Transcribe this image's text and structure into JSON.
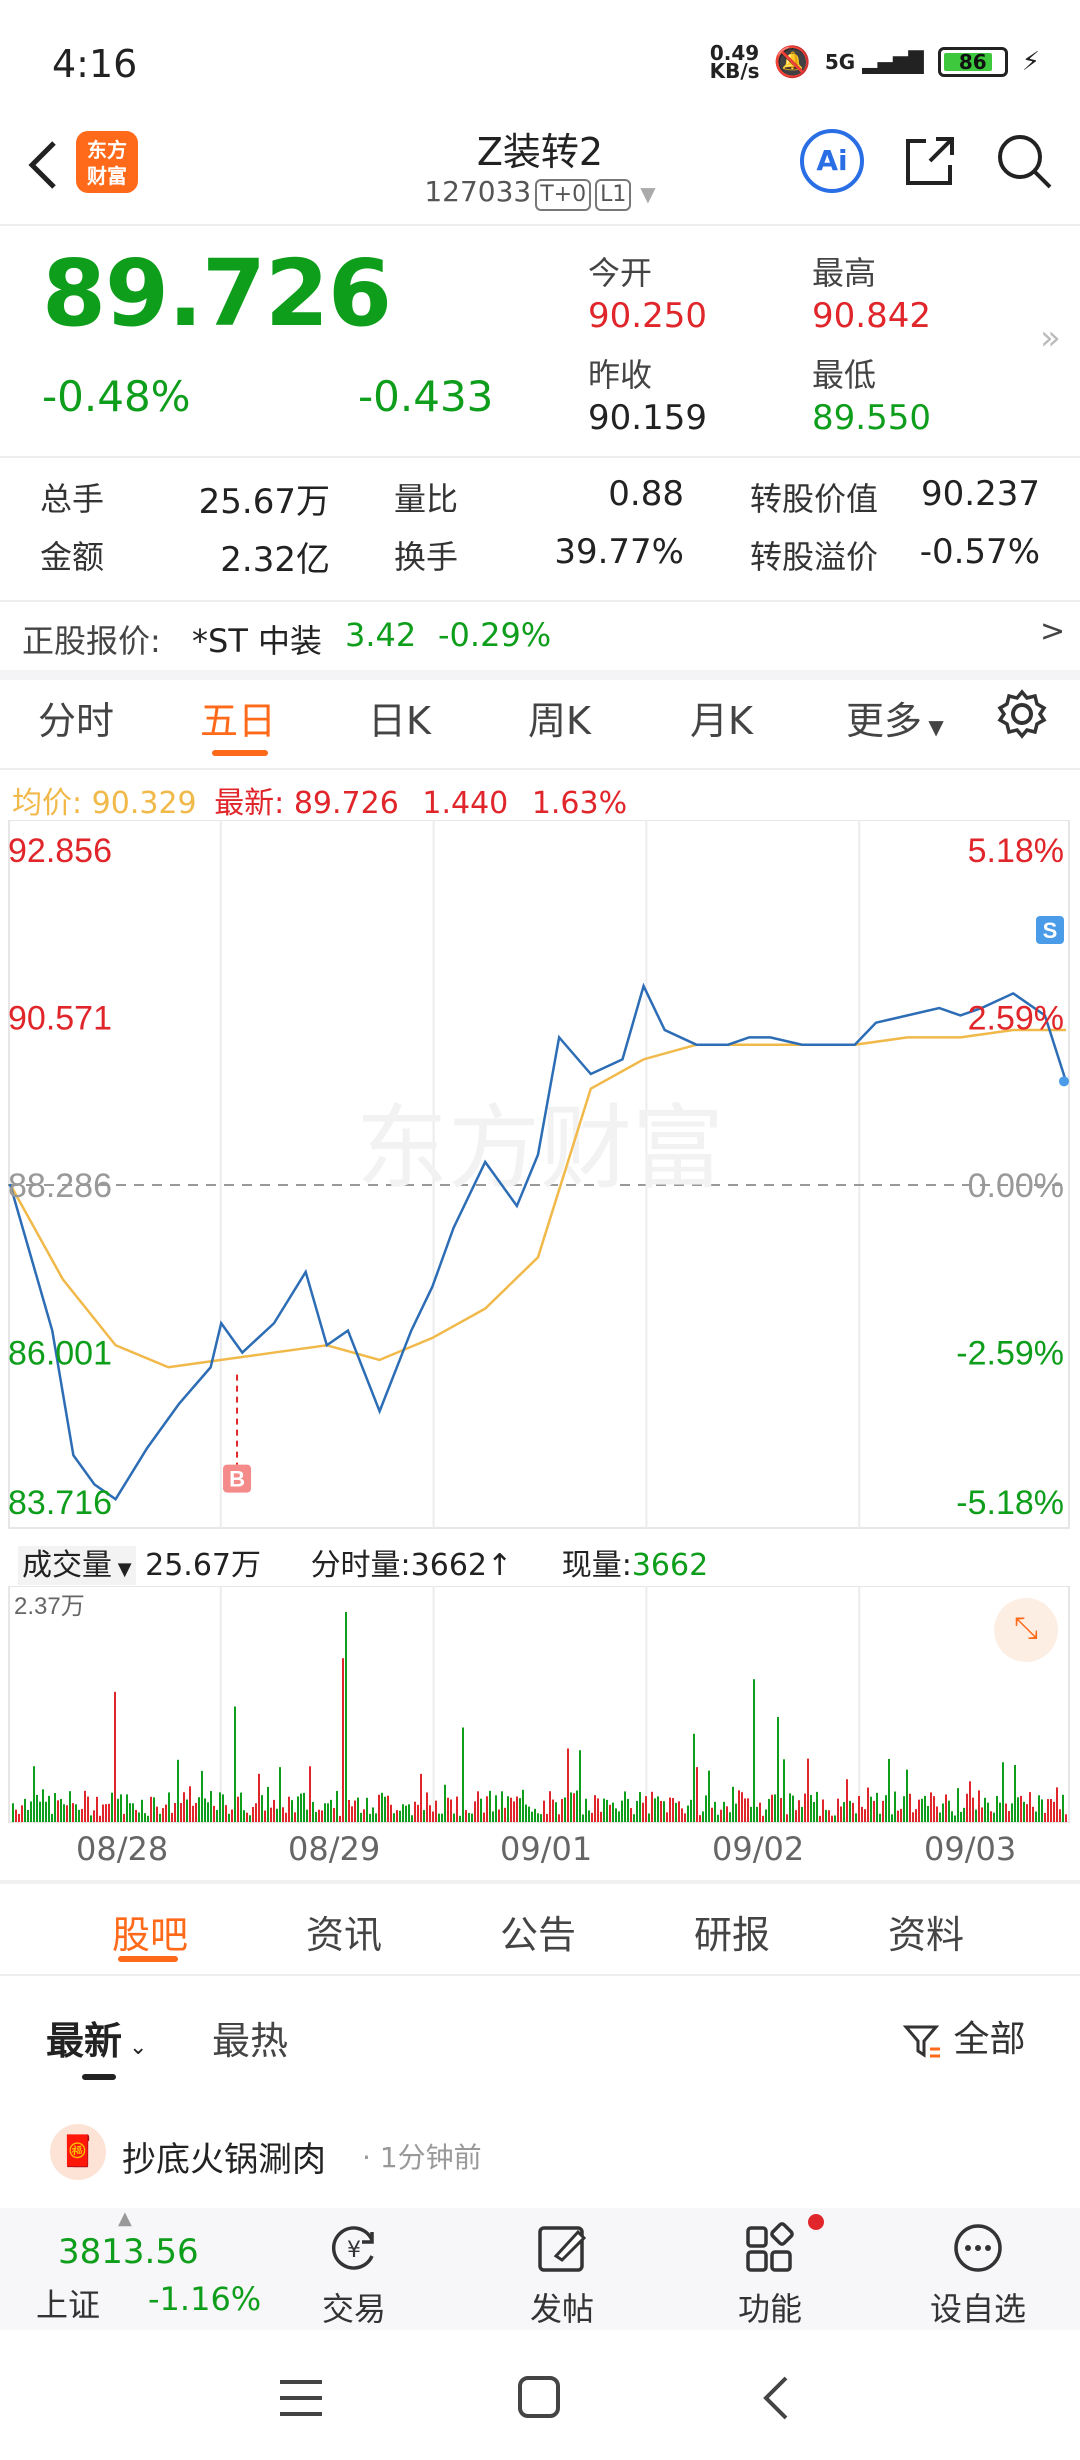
{
  "status_bar": {
    "time": "4:16",
    "net_speed_top": "0.49",
    "net_speed_unit": "KB/s",
    "signal": "5G",
    "battery": "86"
  },
  "header": {
    "logo_text": "东方财富",
    "title": "Z装转2",
    "code": "127033",
    "tag1": "T+0",
    "tag2": "L1"
  },
  "quote": {
    "price": "89.726",
    "change_pct": "-0.48%",
    "change": "-0.433",
    "open_label": "今开",
    "open": "90.250",
    "high_label": "最高",
    "high": "90.842",
    "prev_close_label": "昨收",
    "prev_close": "90.159",
    "low_label": "最低",
    "low": "89.550"
  },
  "stats": [
    {
      "label": "总手",
      "value": "25.67万",
      "color": "#222222"
    },
    {
      "label": "量比",
      "value": "0.88",
      "color": "#222222"
    },
    {
      "label": "转股价值",
      "value": "90.237",
      "color": "#222222"
    },
    {
      "label": "金额",
      "value": "2.32亿",
      "color": "#222222"
    },
    {
      "label": "换手",
      "value": "39.77%",
      "color": "#222222"
    },
    {
      "label": "转股溢价",
      "value": "-0.57%",
      "color": "#0f9e1c"
    }
  ],
  "underlying": {
    "label": "正股报价:",
    "name": "*ST 中装",
    "price": "3.42",
    "change": "-0.29%"
  },
  "ktabs": [
    {
      "label": "分时"
    },
    {
      "label": "五日"
    },
    {
      "label": "日K"
    },
    {
      "label": "周K"
    },
    {
      "label": "月K"
    },
    {
      "label": "更多"
    }
  ],
  "active_ktab": "五日",
  "chart_info": {
    "avg_label": "均价:",
    "avg": "90.329",
    "latest_label": "最新:",
    "latest": "89.726",
    "amp": "1.440",
    "amp_pct": "1.63%"
  },
  "volume_info": {
    "label": "成交量",
    "total": "25.67万",
    "tick_label": "分时量:3662↑",
    "now_label": "现量:",
    "now": "3662",
    "max": "2.37万"
  },
  "watermark": "东方财富",
  "chart_data": {
    "type": "line",
    "title": "",
    "y_left_ticks": [
      "92.856",
      "90.571",
      "88.286",
      "86.001",
      "83.716"
    ],
    "y_right_ticks": [
      "5.18%",
      "2.59%",
      "0.00%",
      "-2.59%",
      "-5.18%"
    ],
    "ylim": [
      83.716,
      92.856
    ],
    "prev_close": 88.286,
    "x_dates": [
      "08/28",
      "08/29",
      "09/01",
      "09/02",
      "09/03"
    ],
    "markers": [
      {
        "label": "B",
        "date": "08/28"
      },
      {
        "label": "S",
        "date": "09/03"
      }
    ],
    "series": [
      {
        "color": "#2c6db5",
        "x": [
          0,
          0.02,
          0.04,
          0.06,
          0.08,
          0.1,
          0.13,
          0.16,
          0.19,
          0.2,
          0.22,
          0.25,
          0.28,
          0.3,
          0.32,
          0.35,
          0.38,
          0.4,
          0.42,
          0.45,
          0.48,
          0.5,
          0.52,
          0.55,
          0.58,
          0.6,
          0.62,
          0.65,
          0.68,
          0.7,
          0.72,
          0.75,
          0.78,
          0.8,
          0.82,
          0.85,
          0.88,
          0.9,
          0.92,
          0.95,
          0.98,
          1.0
        ],
        "y": [
          88.3,
          87.3,
          86.3,
          84.6,
          84.2,
          84.0,
          84.7,
          85.3,
          85.8,
          86.4,
          86.0,
          86.4,
          87.1,
          86.1,
          86.3,
          85.2,
          86.3,
          86.9,
          87.7,
          88.6,
          88.0,
          88.7,
          90.3,
          89.8,
          90.0,
          91.0,
          90.4,
          90.2,
          90.2,
          90.3,
          90.3,
          90.2,
          90.2,
          90.2,
          90.5,
          90.6,
          90.7,
          90.6,
          90.7,
          90.9,
          90.6,
          89.7
        ]
      },
      {
        "color": "#f0b94a",
        "x": [
          0,
          0.05,
          0.1,
          0.15,
          0.2,
          0.25,
          0.3,
          0.35,
          0.4,
          0.45,
          0.5,
          0.55,
          0.6,
          0.65,
          0.7,
          0.75,
          0.8,
          0.85,
          0.9,
          0.95,
          1.0
        ],
        "y": [
          88.3,
          87.0,
          86.1,
          85.8,
          85.9,
          86.0,
          86.1,
          85.9,
          86.2,
          86.6,
          87.3,
          89.6,
          90.0,
          90.2,
          90.2,
          90.2,
          90.2,
          90.3,
          90.3,
          90.4,
          90.4
        ]
      }
    ]
  },
  "bottom_tabs": [
    {
      "label": "股吧"
    },
    {
      "label": "资讯"
    },
    {
      "label": "公告"
    },
    {
      "label": "研报"
    },
    {
      "label": "资料"
    }
  ],
  "active_bottom_tab": "股吧",
  "feed": {
    "sort_latest": "最新",
    "sort_hot": "最热",
    "filter": "全部",
    "post_user": "抄底火锅涮肉",
    "post_time": "1分钟前"
  },
  "index": {
    "value": "3813.56",
    "name": "上证",
    "change": "-1.16%"
  },
  "nav": [
    {
      "label": "交易",
      "icon": "yen-circle-icon"
    },
    {
      "label": "发帖",
      "icon": "edit-icon"
    },
    {
      "label": "功能",
      "icon": "grid-icon"
    },
    {
      "label": "设自选",
      "icon": "more-circle-icon"
    }
  ],
  "colors": {
    "accent": "#ff6a1a",
    "up": "#e0262a",
    "down": "#0f9e1c",
    "price_line": "#2c6db5",
    "avg_line": "#f0b94a"
  }
}
